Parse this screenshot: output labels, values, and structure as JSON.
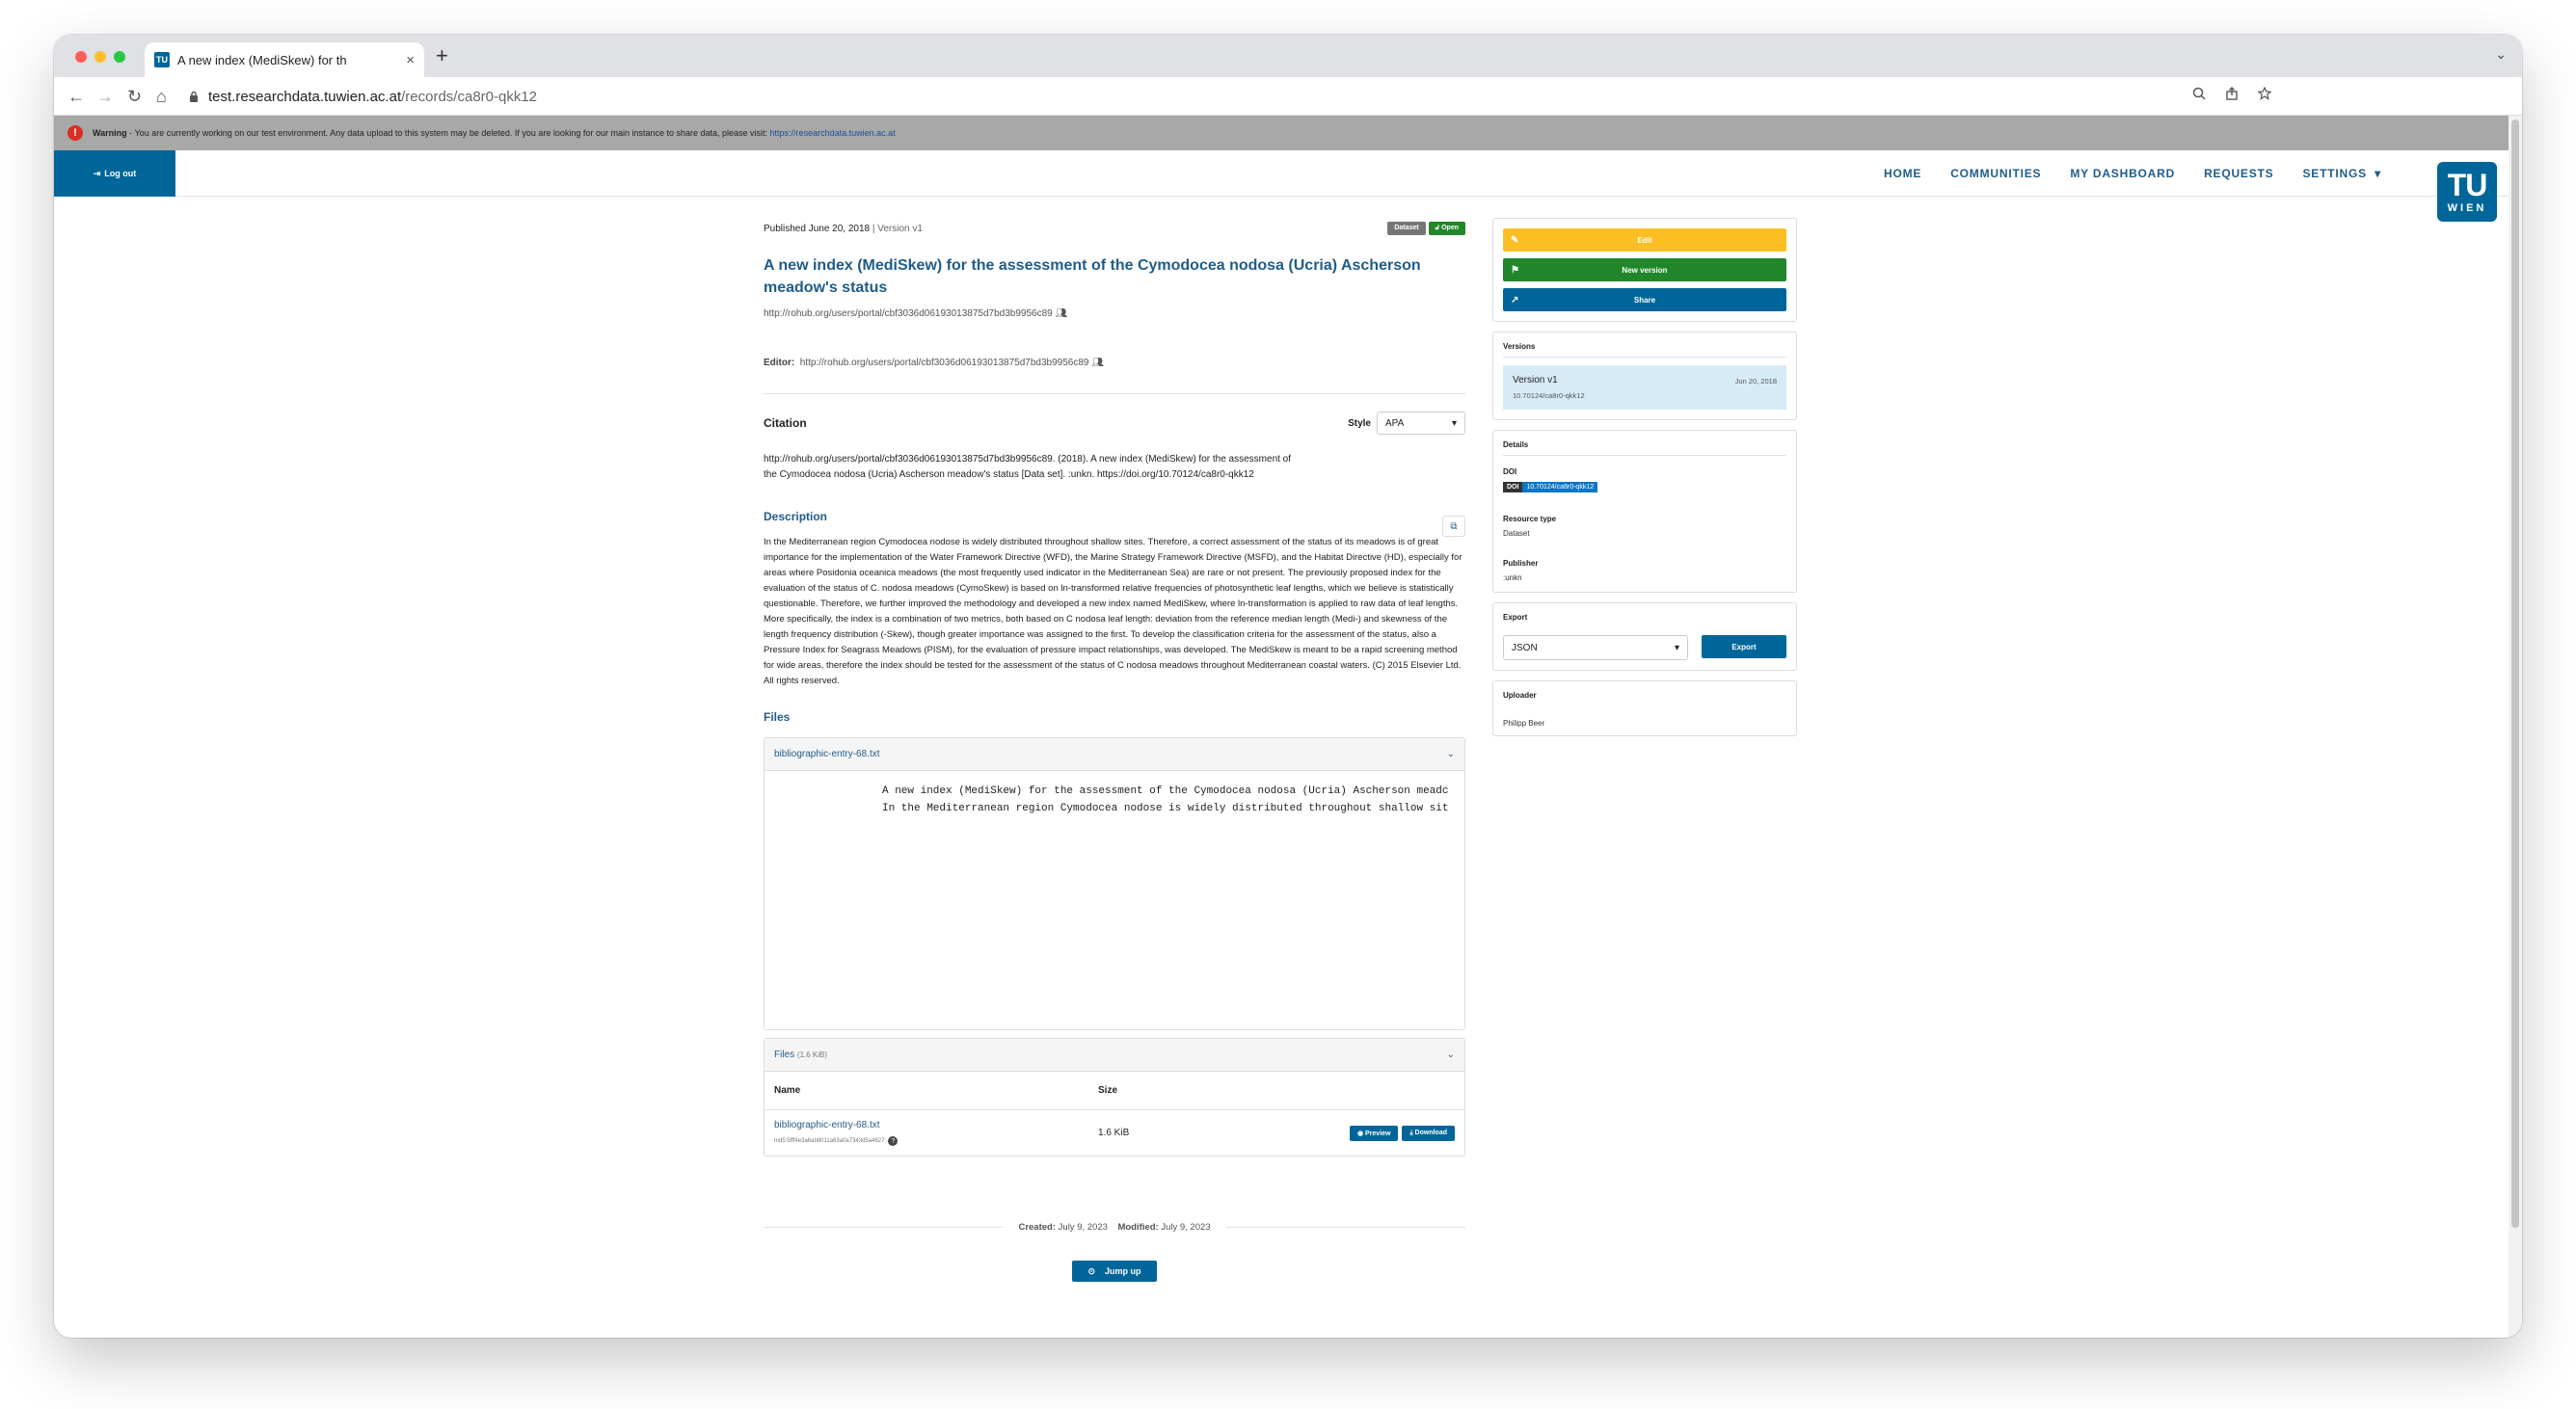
{
  "browser": {
    "tab_title": "A new index (MediSkew) for th",
    "tab_close": "×",
    "new_tab": "+",
    "tabs_menu": "⌄",
    "url_host": "test.researchdata.tuwien.ac.at",
    "url_path": "/records/ca8r0-qkk12",
    "nav": {
      "back": "←",
      "forward": "→",
      "reload": "↻",
      "home": "⌂"
    }
  },
  "warning": {
    "label": "Warning",
    "text": " - You are currently working on our test environment. Any data upload to this system may be deleted. If you are looking for our main instance to share data, please visit: ",
    "link": "https://researchdata.tuwien.ac.at"
  },
  "navbar": {
    "logout": "Log out",
    "menu": [
      "HOME",
      "COMMUNITIES",
      "MY DASHBOARD",
      "REQUESTS",
      "SETTINGS"
    ],
    "settings_caret": "▾",
    "logo_top": "TU",
    "logo_bottom": "WIEN"
  },
  "record": {
    "published": "Published June 20, 2018",
    "separator": " | ",
    "version": "Version v1",
    "badge_type": "Dataset",
    "badge_access": "Open",
    "title": "A new index (MediSkew) for the assessment of the Cymodocea nodosa (Ucria) Ascherson meadow's status",
    "creator": "http://rohub.org/users/portal/cbf3036d06193013875d7bd3b9956c89",
    "editor_label": "Editor:",
    "editor": "http://rohub.org/users/portal/cbf3036d06193013875d7bd3b9956c89"
  },
  "citation": {
    "heading": "Citation",
    "style_label": "Style",
    "style_value": "APA",
    "text": "http://rohub.org/users/portal/cbf3036d06193013875d7bd3b9956c89. (2018). A new index (MediSkew) for the assessment of the Cymodocea nodosa (Ucria) Ascherson meadow's status [Data set]. :unkn. https://doi.org/10.70124/ca8r0-qkk12"
  },
  "description": {
    "heading": "Description",
    "text": "In the Mediterranean region Cymodocea nodose is widely distributed throughout shallow sites. Therefore, a correct assessment of the status of its meadows is of great importance for the implementation of the Water Framework Directive (WFD), the Marine Strategy Framework Directive (MSFD), and the Habitat Directive (HD), especially for areas where Posidonia oceanica meadows (the most frequently used indicator in the Mediterranean Sea) are rare or not present. The previously proposed index for the evaluation of the status of C. nodosa meadows (CymoSkew) is based on ln-transformed relative frequencies of photosynthetic leaf lengths, which we believe is statistically questionable. Therefore, we further improved the methodology and developed a new index named MediSkew, where ln-transformation is applied to raw data of leaf lengths. More specifically, the index is a combination of two metrics, both based on C nodosa leaf length: deviation from the reference median length (Medi-) and skewness of the length frequency distribution (-Skew), though greater importance was assigned to the first. To develop the classification criteria for the assessment of the status, also a Pressure Index for Seagrass Meadows (PISM), for the evaluation of pressure impact relationships, was developed. The MediSkew is meant to be a rapid screening method for wide areas, therefore the index should be tested for the assessment of the status of C nodosa meadows throughout Mediterranean coastal waters. (C) 2015 Elsevier Ltd. All rights reserved."
  },
  "files": {
    "heading": "Files",
    "preview_file": "bibliographic-entry-68.txt",
    "preview_lines": [
      "A new index (MediSkew) for the assessment of the Cymodocea nodosa (Ucria) Ascherson meadc",
      "In the Mediterranean region Cymodocea nodose is widely distributed throughout shallow sit"
    ],
    "list_label": "Files",
    "list_size": "(1.6 KiB)",
    "col_name": "Name",
    "col_size": "Size",
    "rows": [
      {
        "name": "bibliographic-entry-68.txt",
        "checksum": "md5:5fff4e3a6ab8011a63a0a7343d5a4627",
        "size": "1.6 KiB"
      }
    ],
    "preview_btn": "Preview",
    "download_btn": "Download"
  },
  "footer": {
    "created_label": "Created:",
    "created": "July 9, 2023",
    "modified_label": "Modified:",
    "modified": "July 9, 2023",
    "jump": "Jump up"
  },
  "sidebar": {
    "edit": "Edit",
    "new_version": "New version",
    "share": "Share",
    "versions_heading": "Versions",
    "version_name": "Version v1",
    "version_date": "Jun 20, 2018",
    "version_doi": "10.70124/ca8r0-qkk12",
    "details_heading": "Details",
    "doi_label": "DOI",
    "doi_key": "DOI",
    "doi_value": "10.70124/ca8r0-qkk12",
    "resource_type_label": "Resource type",
    "resource_type": "Dataset",
    "publisher_label": "Publisher",
    "publisher": ":unkn",
    "export_heading": "Export",
    "export_format": "JSON",
    "export_btn": "Export",
    "uploader_heading": "Uploader",
    "uploader": "Philipp Beer"
  },
  "colors": {
    "brand": "#006699",
    "link": "#1f5c8a",
    "edit": "#fbbf24",
    "new_version": "#21862a",
    "warning_bar": "#a8a8a8"
  }
}
